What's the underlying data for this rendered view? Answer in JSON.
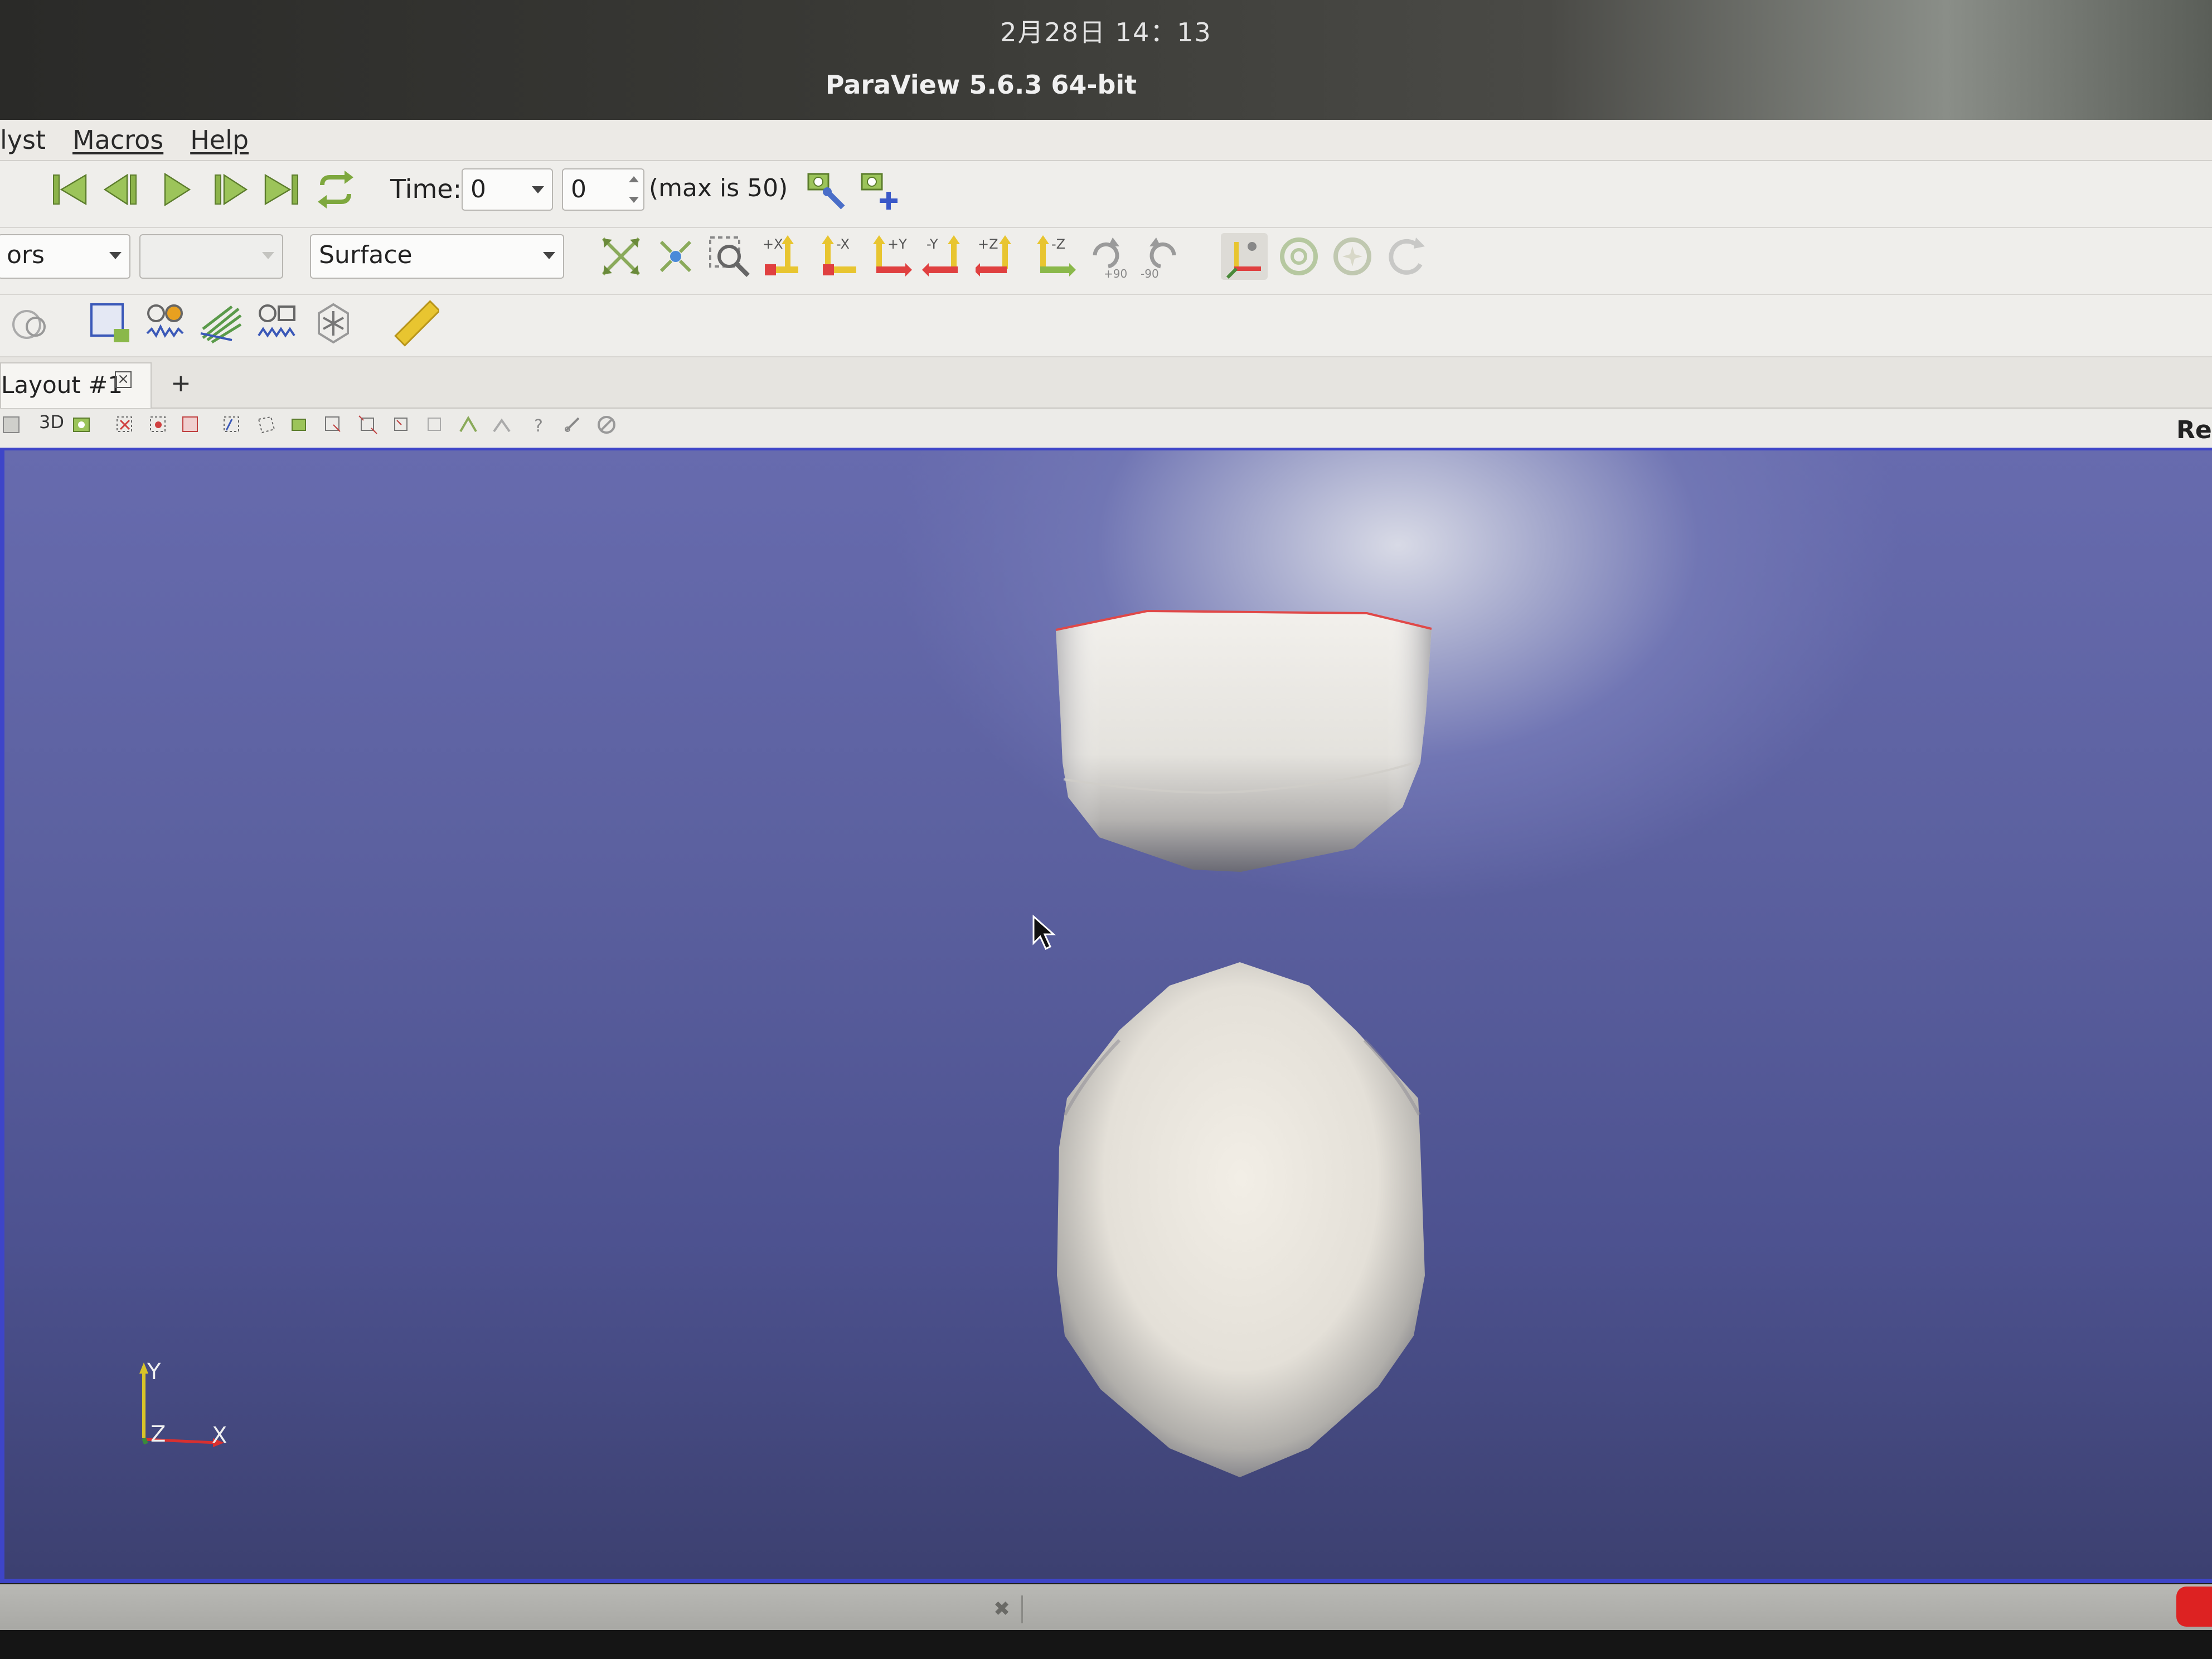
{
  "system": {
    "clock": "2月28日  14：13"
  },
  "window": {
    "title": "ParaView 5.6.3 64-bit"
  },
  "menubar": {
    "items": [
      "lyst",
      "Macros",
      "Help"
    ]
  },
  "vcr_toolbar": {
    "buttons": [
      "first-frame",
      "previous-frame",
      "play",
      "next-frame",
      "last-frame",
      "loop"
    ],
    "time_label": "Time:",
    "time_value": "0",
    "timestep_value": "0",
    "max_label": "(max is 50)"
  },
  "representation_toolbar": {
    "coloring_value": "ors",
    "component_value": "",
    "representation_value": "Surface"
  },
  "camera_toolbar": {
    "buttons": [
      "reset-camera",
      "zoom-to-data",
      "zoom-to-box",
      "+X",
      "-X",
      "+Y",
      "-Y",
      "+Z",
      "-Z",
      "+90",
      "-90"
    ]
  },
  "layout": {
    "tabs": [
      {
        "label": "Layout #1"
      }
    ],
    "add_tab": "+",
    "view_mode": "3D",
    "right_label": "Ren"
  },
  "render_view": {
    "background_colors": [
      "#676bae",
      "#3c4070"
    ],
    "object_color": "#e8e6e2",
    "orientation_axes": {
      "y_label": "Y",
      "z_label": "Z",
      "x_label": "X"
    }
  },
  "status": {
    "icon": "close-icon"
  }
}
